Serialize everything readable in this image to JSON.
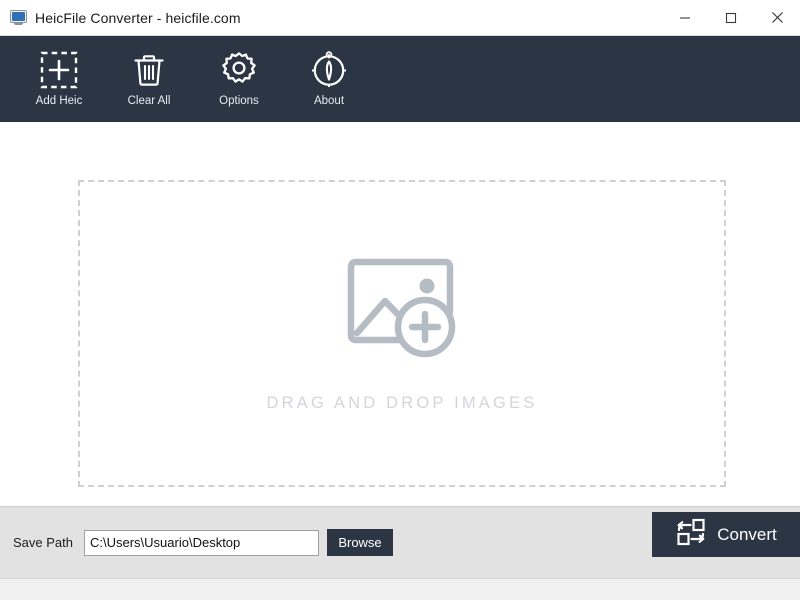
{
  "window": {
    "title": "HeicFile Converter - heicfile.com",
    "app_icon": "monitor-icon",
    "controls": {
      "minimize": "minimize-icon",
      "maximize": "maximize-icon",
      "close": "close-icon"
    }
  },
  "toolbar": {
    "background_color": "#2b3544",
    "items": [
      {
        "label": "Add Heic",
        "icon": "add-image-dashed-icon"
      },
      {
        "label": "Clear All",
        "icon": "trash-icon"
      },
      {
        "label": "Options",
        "icon": "gear-icon"
      },
      {
        "label": "About",
        "icon": "compass-icon"
      }
    ]
  },
  "dropzone": {
    "text": "DRAG AND DROP IMAGES",
    "icon": "image-plus-icon",
    "border_color": "#cdd1d6",
    "text_color": "#d2d6da"
  },
  "bottom": {
    "save_path_label": "Save Path",
    "save_path_value": "C:\\Users\\Usuario\\Desktop",
    "save_path_placeholder": "C:\\Users\\Usuario\\Desktop",
    "browse_label": "Browse",
    "convert_label": "Convert",
    "convert_icon": "convert-cycle-icon",
    "accent_color": "#2b3544",
    "bar_color": "#e2e2e2"
  }
}
